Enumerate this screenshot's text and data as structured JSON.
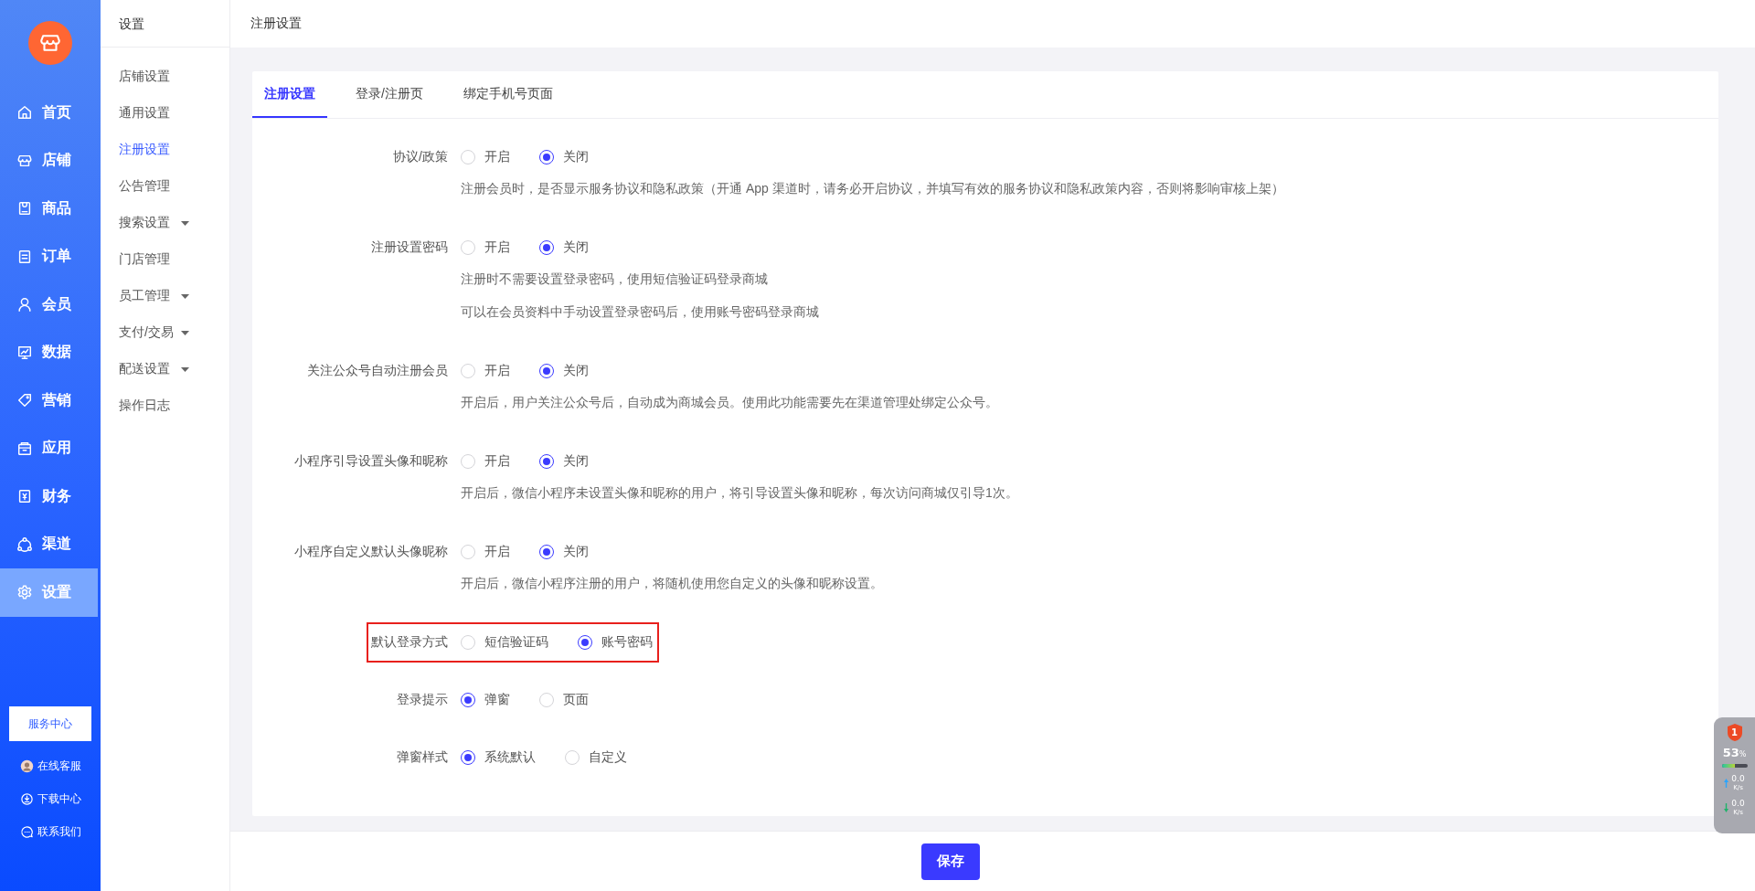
{
  "sidebar": {
    "nav": [
      {
        "label": "首页",
        "kind": "home",
        "selected": false
      },
      {
        "label": "店铺",
        "kind": "store",
        "selected": false
      },
      {
        "label": "商品",
        "kind": "goods",
        "selected": false
      },
      {
        "label": "订单",
        "kind": "order",
        "selected": false
      },
      {
        "label": "会员",
        "kind": "member",
        "selected": false
      },
      {
        "label": "数据",
        "kind": "data",
        "selected": false
      },
      {
        "label": "营销",
        "kind": "tag",
        "selected": false
      },
      {
        "label": "应用",
        "kind": "app",
        "selected": false
      },
      {
        "label": "财务",
        "kind": "finance",
        "selected": false
      },
      {
        "label": "渠道",
        "kind": "channel",
        "selected": false
      },
      {
        "label": "设置",
        "kind": "settings",
        "selected": true
      }
    ],
    "service_button": "服务中心",
    "links": [
      {
        "label": "在线客服",
        "kind": "avatar"
      },
      {
        "label": "下载中心",
        "kind": "download"
      },
      {
        "label": "联系我们",
        "kind": "chat"
      }
    ]
  },
  "submenu": {
    "title": "设置",
    "items": [
      {
        "label": "店铺设置",
        "selected": false,
        "expandable": false
      },
      {
        "label": "通用设置",
        "selected": false,
        "expandable": false
      },
      {
        "label": "注册设置",
        "selected": true,
        "expandable": false
      },
      {
        "label": "公告管理",
        "selected": false,
        "expandable": false
      },
      {
        "label": "搜索设置",
        "selected": false,
        "expandable": true
      },
      {
        "label": "门店管理",
        "selected": false,
        "expandable": false
      },
      {
        "label": "员工管理",
        "selected": false,
        "expandable": true
      },
      {
        "label": "支付/交易",
        "selected": false,
        "expandable": true
      },
      {
        "label": "配送设置",
        "selected": false,
        "expandable": true
      },
      {
        "label": "操作日志",
        "selected": false,
        "expandable": false
      }
    ]
  },
  "header": {
    "title": "注册设置"
  },
  "tabs": [
    {
      "label": "注册设置",
      "selected": true
    },
    {
      "label": "登录/注册页",
      "selected": false
    },
    {
      "label": "绑定手机号页面",
      "selected": false
    }
  ],
  "fields": [
    {
      "label": "协议/政策",
      "highlighted": false,
      "options": [
        {
          "label": "开启",
          "selected": false
        },
        {
          "label": "关闭",
          "selected": true
        }
      ],
      "hints": [
        "注册会员时，是否显示服务协议和隐私政策（开通 App 渠道时，请务必开启协议，并填写有效的服务协议和隐私政策内容，否则将影响审核上架）"
      ]
    },
    {
      "label": "注册设置密码",
      "highlighted": false,
      "options": [
        {
          "label": "开启",
          "selected": false
        },
        {
          "label": "关闭",
          "selected": true
        }
      ],
      "hints": [
        "注册时不需要设置登录密码，使用短信验证码登录商城",
        "可以在会员资料中手动设置登录密码后，使用账号密码登录商城"
      ]
    },
    {
      "label": "关注公众号自动注册会员",
      "highlighted": false,
      "options": [
        {
          "label": "开启",
          "selected": false
        },
        {
          "label": "关闭",
          "selected": true
        }
      ],
      "hints": [
        "开启后，用户关注公众号后，自动成为商城会员。使用此功能需要先在渠道管理处绑定公众号。"
      ]
    },
    {
      "label": "小程序引导设置头像和昵称",
      "highlighted": false,
      "options": [
        {
          "label": "开启",
          "selected": false
        },
        {
          "label": "关闭",
          "selected": true
        }
      ],
      "hints": [
        "开启后，微信小程序未设置头像和昵称的用户，将引导设置头像和昵称，每次访问商城仅引导1次。"
      ]
    },
    {
      "label": "小程序自定义默认头像昵称",
      "highlighted": false,
      "options": [
        {
          "label": "开启",
          "selected": false
        },
        {
          "label": "关闭",
          "selected": true
        }
      ],
      "hints": [
        "开启后，微信小程序注册的用户，将随机使用您自定义的头像和昵称设置。"
      ]
    },
    {
      "label": "默认登录方式",
      "highlighted": true,
      "options": [
        {
          "label": "短信验证码",
          "selected": false
        },
        {
          "label": "账号密码",
          "selected": true
        }
      ]
    },
    {
      "label": "登录提示",
      "highlighted": false,
      "options": [
        {
          "label": "弹窗",
          "selected": true
        },
        {
          "label": "页面",
          "selected": false
        }
      ]
    },
    {
      "label": "弹窗样式",
      "highlighted": false,
      "options": [
        {
          "label": "系统默认",
          "selected": true
        },
        {
          "label": "自定义",
          "selected": false
        }
      ]
    }
  ],
  "save_button": "保存",
  "monitor": {
    "badge": "1",
    "percent": "53",
    "percent_unit": "%",
    "level": 0.53,
    "upload": "0.0",
    "upload_unit": "K/s",
    "download": "0.0",
    "download_unit": "K/s"
  }
}
